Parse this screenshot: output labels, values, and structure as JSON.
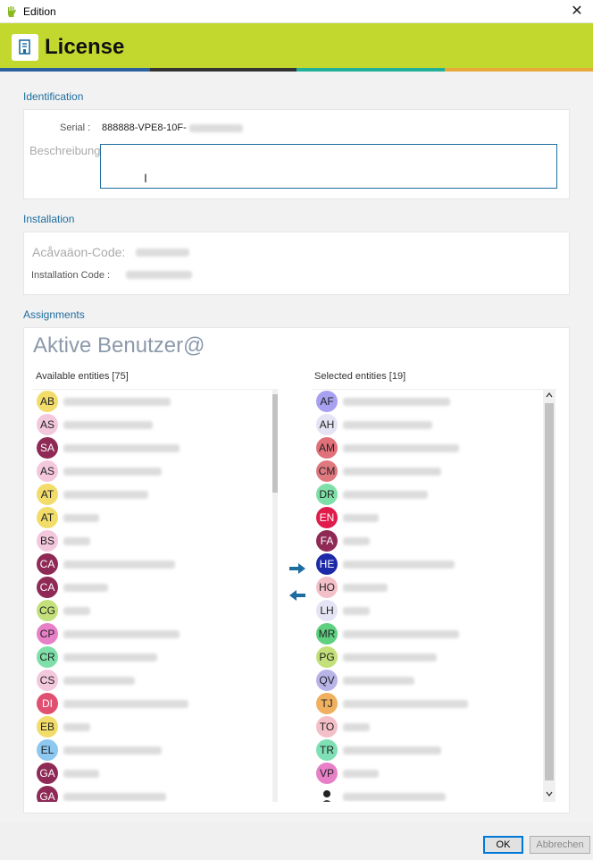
{
  "window": {
    "title": "Edition",
    "close_glyph": "✕"
  },
  "banner": {
    "title": "License",
    "icon": "license-document-icon",
    "bg": "#c3d82e"
  },
  "identification": {
    "label": "Identification",
    "serial_label": "Serial :",
    "serial_value": "888888-VPE8-10F-",
    "description_label": "Beschreibung:",
    "description_value": ""
  },
  "installation": {
    "label": "Installation",
    "activation_label": "Acåvaäon-Code:",
    "install_code_label": "Installation Code :"
  },
  "assignments": {
    "label": "Assignments",
    "title": "Aktive Benutzer@",
    "available_header": "Available entities [75]",
    "selected_header": "Selected entities [19]",
    "available": [
      {
        "initials": "AB",
        "color": "#f2dc6a",
        "dark": false
      },
      {
        "initials": "AS",
        "color": "#f3c7dc",
        "dark": false
      },
      {
        "initials": "SA",
        "color": "#8e2a55",
        "dark": true
      },
      {
        "initials": "AS",
        "color": "#f3c7dc",
        "dark": false
      },
      {
        "initials": "AT",
        "color": "#f2dc6a",
        "dark": false
      },
      {
        "initials": "AT",
        "color": "#f2dc6a",
        "dark": false
      },
      {
        "initials": "BS",
        "color": "#f3c7dc",
        "dark": false
      },
      {
        "initials": "CA",
        "color": "#8e2a55",
        "dark": true
      },
      {
        "initials": "CA",
        "color": "#8e2a55",
        "dark": true
      },
      {
        "initials": "CG",
        "color": "#c4e07a",
        "dark": false
      },
      {
        "initials": "CP",
        "color": "#e880c8",
        "dark": false
      },
      {
        "initials": "CR",
        "color": "#7ee0a8",
        "dark": false
      },
      {
        "initials": "CS",
        "color": "#f3c7dc",
        "dark": false
      },
      {
        "initials": "DI",
        "color": "#e05070",
        "dark": true
      },
      {
        "initials": "EB",
        "color": "#f2dc6a",
        "dark": false
      },
      {
        "initials": "EL",
        "color": "#8cc8f0",
        "dark": false
      },
      {
        "initials": "GA",
        "color": "#8e2a55",
        "dark": true
      },
      {
        "initials": "GA",
        "color": "#8e2a55",
        "dark": true
      }
    ],
    "selected": [
      {
        "initials": "AF",
        "color": "#a8a0f0",
        "dark": false
      },
      {
        "initials": "AH",
        "color": "#e4e4f4",
        "dark": false
      },
      {
        "initials": "AM",
        "color": "#e0707a",
        "dark": false
      },
      {
        "initials": "CM",
        "color": "#e07880",
        "dark": false
      },
      {
        "initials": "DR",
        "color": "#7ee0a8",
        "dark": false
      },
      {
        "initials": "EN",
        "color": "#e01c4c",
        "dark": true
      },
      {
        "initials": "FA",
        "color": "#8e2a55",
        "dark": true
      },
      {
        "initials": "HE",
        "color": "#1c2aa8",
        "dark": true
      },
      {
        "initials": "HO",
        "color": "#f4c0c8",
        "dark": false
      },
      {
        "initials": "LH",
        "color": "#e4e4f4",
        "dark": false
      },
      {
        "initials": "MR",
        "color": "#5ed080",
        "dark": false
      },
      {
        "initials": "PG",
        "color": "#c4e07a",
        "dark": false
      },
      {
        "initials": "QV",
        "color": "#b8b4e8",
        "dark": false
      },
      {
        "initials": "TJ",
        "color": "#f0b060",
        "dark": false
      },
      {
        "initials": "TO",
        "color": "#f4c0c8",
        "dark": false
      },
      {
        "initials": "TR",
        "color": "#7ee0b4",
        "dark": false
      },
      {
        "initials": "VP",
        "color": "#e880c8",
        "dark": false
      },
      {
        "initials": "",
        "color": "#ffffff",
        "dark": false,
        "icon": "user-photo-icon"
      }
    ]
  },
  "footer": {
    "ok_label": "OK",
    "cancel_label": "Abbrechen"
  },
  "accent_colors": {
    "stripe_blue": "#2a5fa0",
    "stripe_dark": "#333333",
    "stripe_teal": "#20b09a",
    "stripe_orange": "#e8a838",
    "label_blue": "#1e6da0"
  }
}
